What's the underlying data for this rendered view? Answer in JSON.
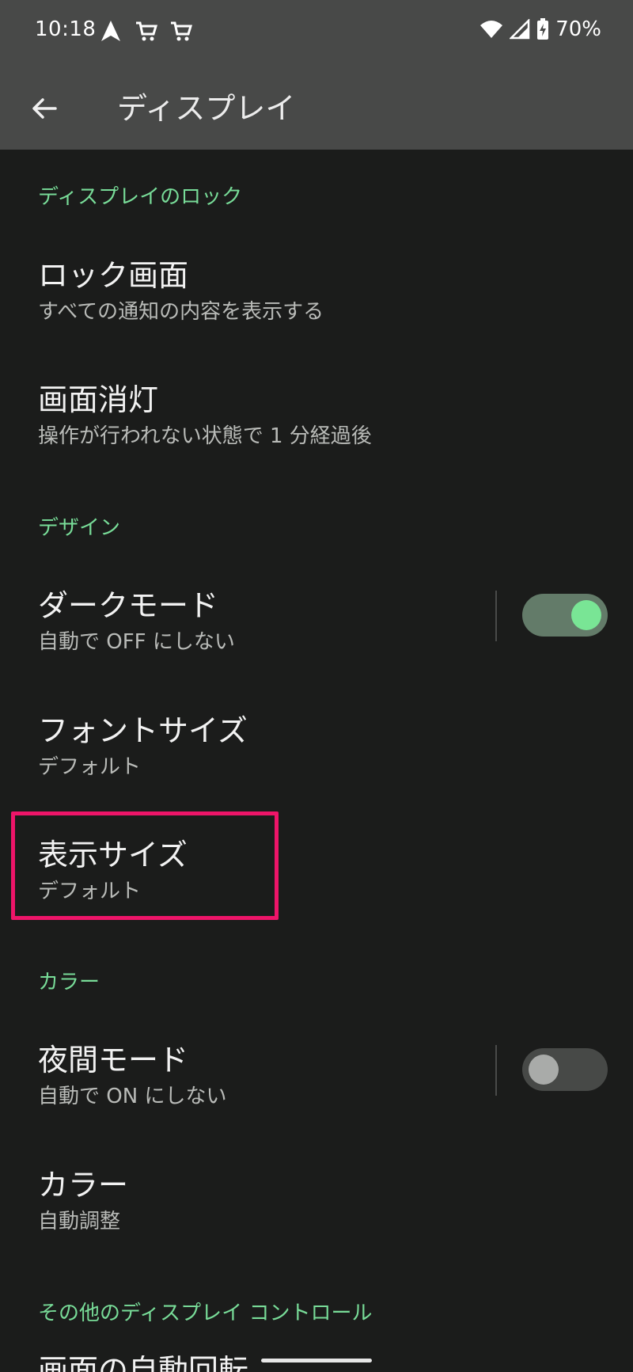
{
  "status_bar": {
    "time": "10:18",
    "battery": "70%",
    "icons": [
      "navigation-arrow-icon",
      "cart-icon",
      "cart-icon",
      "wifi-icon",
      "cell-signal-icon",
      "battery-charging-icon"
    ]
  },
  "app_bar": {
    "title": "ディスプレイ",
    "back_icon": "arrow-left-icon"
  },
  "sections": {
    "lock": {
      "header": "ディスプレイのロック",
      "lock_screen": {
        "title": "ロック画面",
        "subtitle": "すべての通知の内容を表示する"
      },
      "screen_timeout": {
        "title": "画面消灯",
        "subtitle": "操作が行われない状態で 1 分経過後"
      }
    },
    "design": {
      "header": "デザイン",
      "dark_mode": {
        "title": "ダークモード",
        "subtitle": "自動で OFF にしない",
        "enabled": true
      },
      "font_size": {
        "title": "フォントサイズ",
        "subtitle": "デフォルト"
      },
      "display_size": {
        "title": "表示サイズ",
        "subtitle": "デフォルト",
        "highlighted": true
      }
    },
    "color": {
      "header": "カラー",
      "night_light": {
        "title": "夜間モード",
        "subtitle": "自動で ON にしない",
        "enabled": false
      },
      "colors": {
        "title": "カラー",
        "subtitle": "自動調整"
      }
    },
    "other": {
      "header": "その他のディスプレイ コントロール",
      "partial_item": "画面の自動回転"
    }
  },
  "colors": {
    "accent": "#78dc98",
    "highlight_border": "#ee1569",
    "background": "#1b1c1b",
    "bar": "#484948"
  }
}
